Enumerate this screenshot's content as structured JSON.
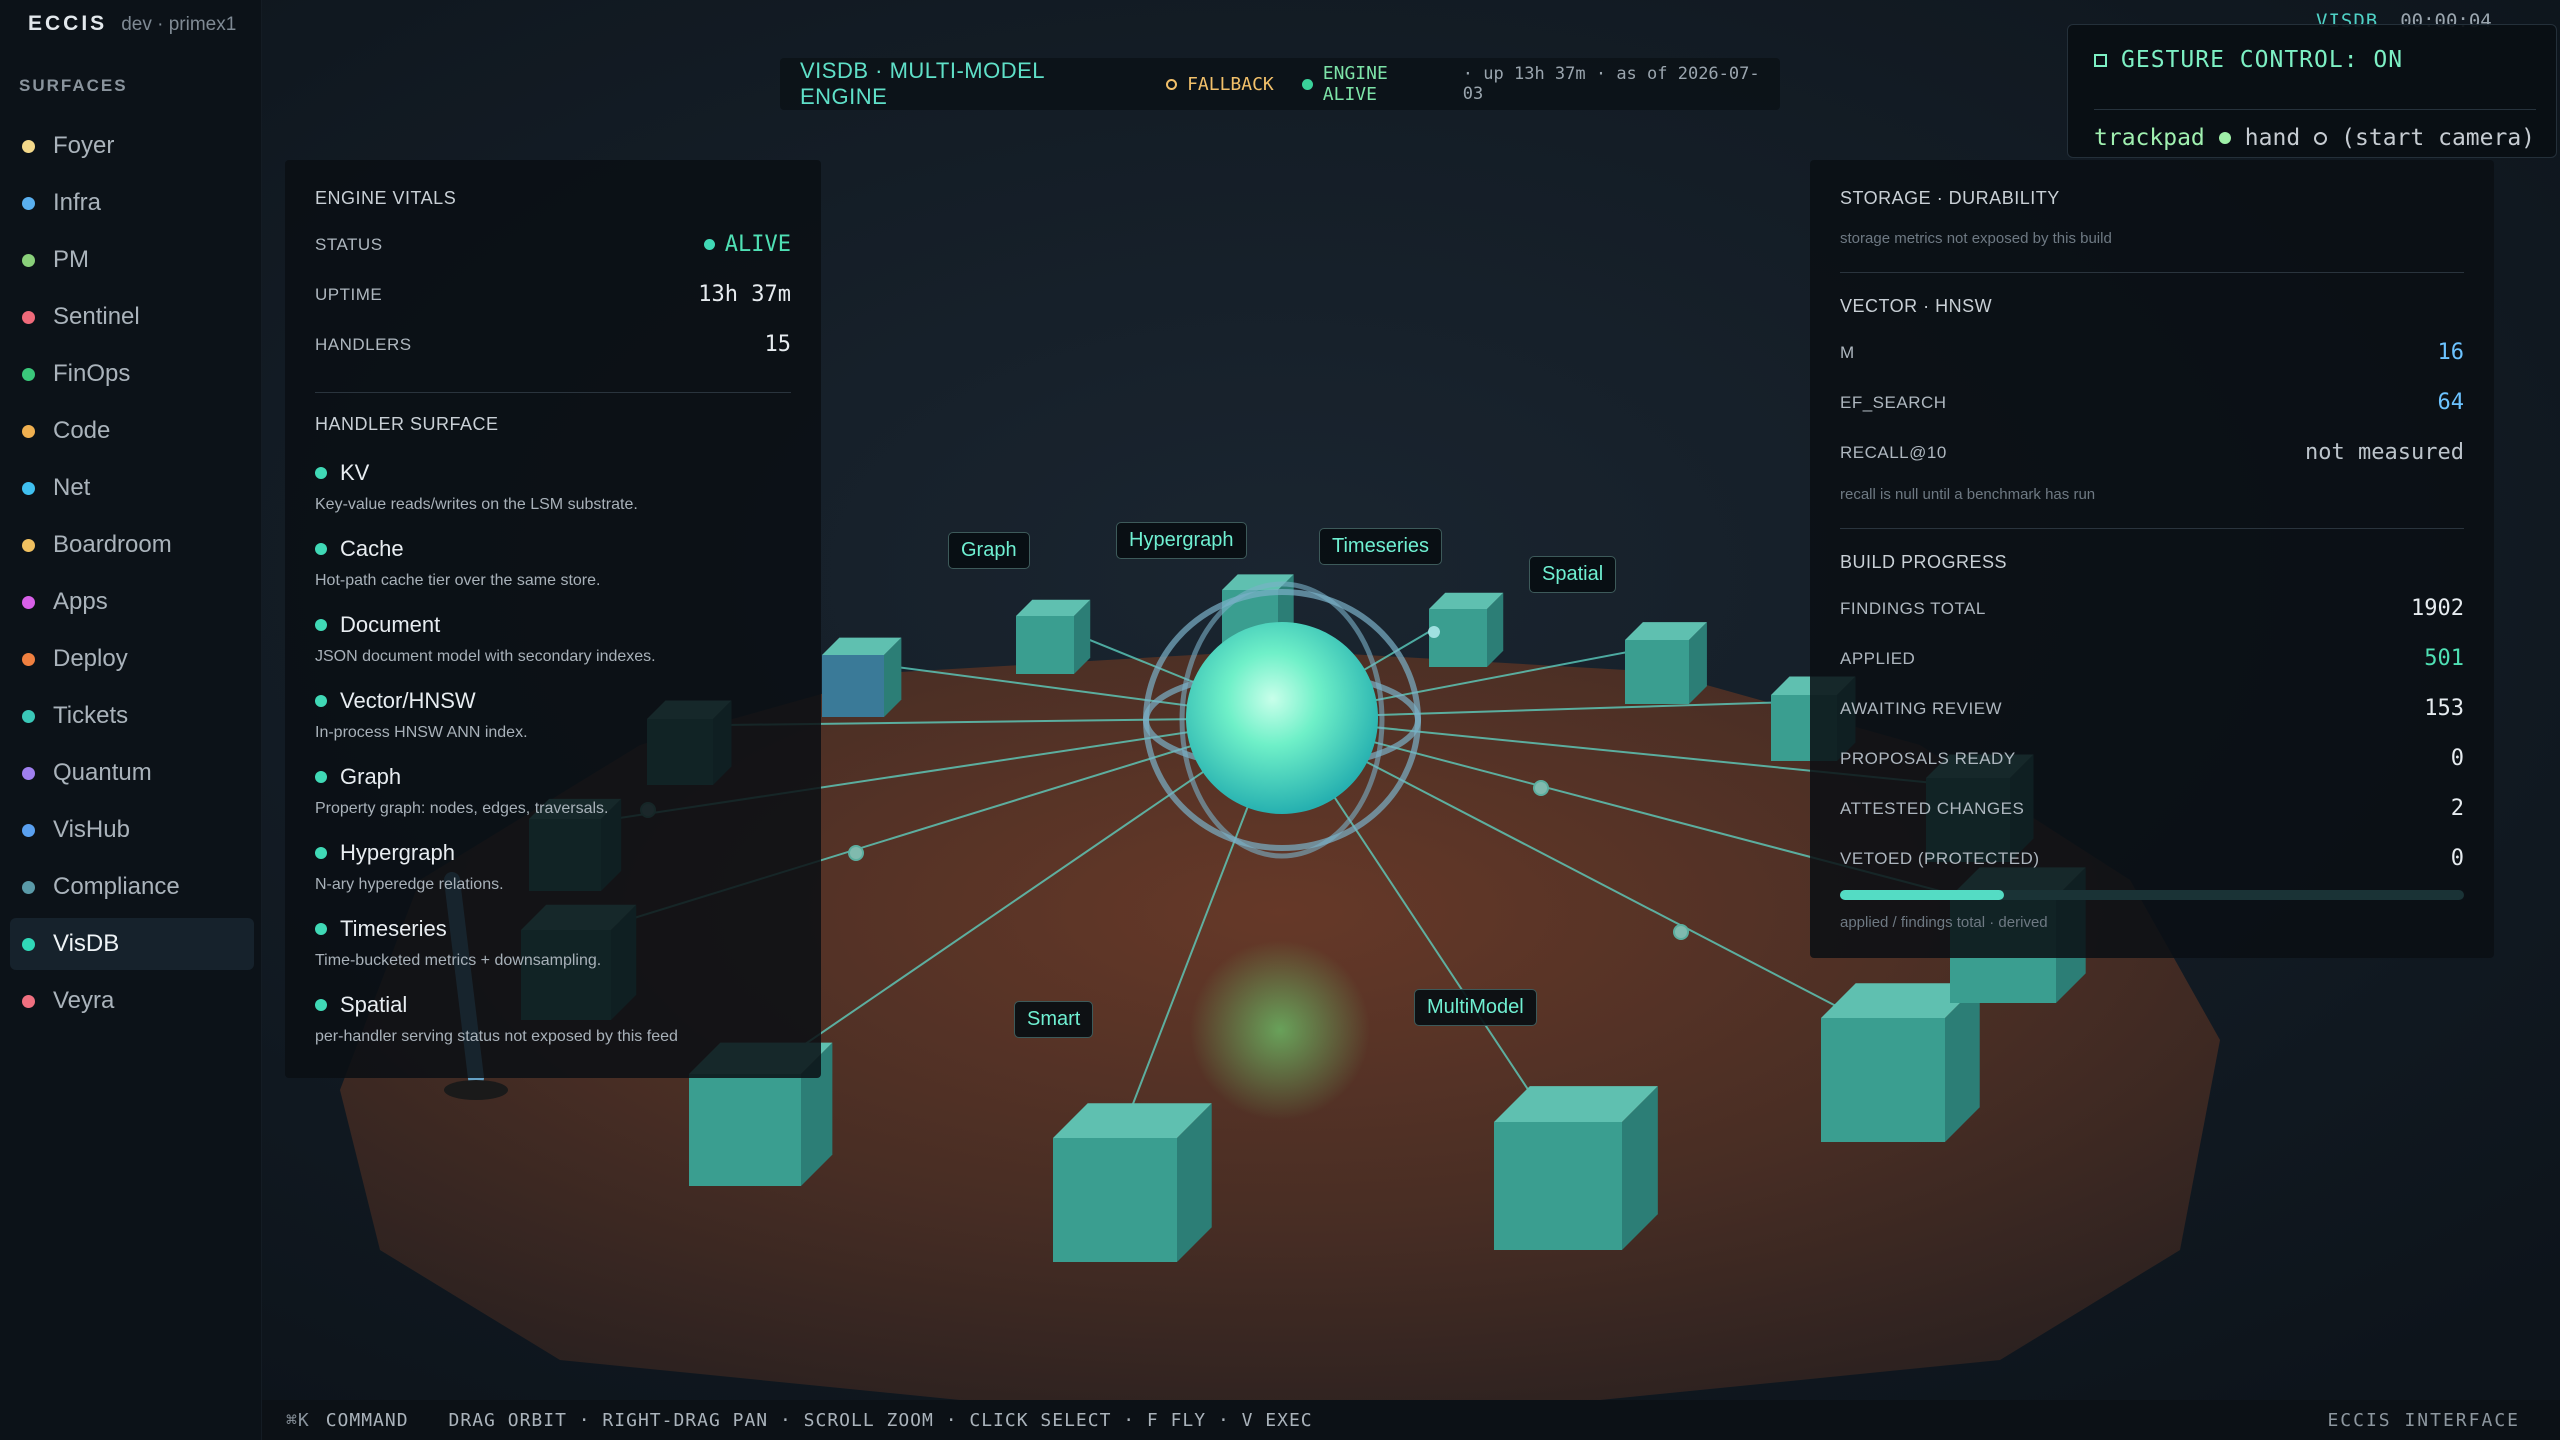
{
  "app": {
    "brand": "ECCIS",
    "env": "dev · primex1"
  },
  "sidebar": {
    "section_label": "SURFACES",
    "items": [
      {
        "label": "Foyer",
        "color": "#f4d98a",
        "active": false
      },
      {
        "label": "Infra",
        "color": "#5ab0f0",
        "active": false
      },
      {
        "label": "PM",
        "color": "#8ad07a",
        "active": false
      },
      {
        "label": "Sentinel",
        "color": "#f06a7a",
        "active": false
      },
      {
        "label": "FinOps",
        "color": "#3ac87a",
        "active": false
      },
      {
        "label": "Code",
        "color": "#f0b050",
        "active": false
      },
      {
        "label": "Net",
        "color": "#40c0f0",
        "active": false
      },
      {
        "label": "Boardroom",
        "color": "#f0c060",
        "active": false
      },
      {
        "label": "Apps",
        "color": "#d860e8",
        "active": false
      },
      {
        "label": "Deploy",
        "color": "#f08040",
        "active": false
      },
      {
        "label": "Tickets",
        "color": "#3ac8b8",
        "active": false
      },
      {
        "label": "Quantum",
        "color": "#a080f0",
        "active": false
      },
      {
        "label": "VisHub",
        "color": "#5aa0f0",
        "active": false
      },
      {
        "label": "Compliance",
        "color": "#5a9aa8",
        "active": false
      },
      {
        "label": "VisDB",
        "color": "#30d8b8",
        "active": true
      },
      {
        "label": "Veyra",
        "color": "#f07080",
        "active": false
      }
    ]
  },
  "header": {
    "title": "VISDB · MULTI-MODEL ENGINE",
    "fallback": "FALLBACK",
    "alive": "ENGINE ALIVE",
    "meta": "· up 13h 37m · as of 2026-07-03"
  },
  "topright": {
    "vis": "VISDB",
    "clock": "00:00:04"
  },
  "gesture": {
    "title": "GESTURE CONTROL: ON",
    "trackpad": "trackpad",
    "hand": "hand",
    "hand_hint": "(start camera)"
  },
  "vitals": {
    "title": "ENGINE VITALS",
    "status_k": "STATUS",
    "status_v": "ALIVE",
    "uptime_k": "UPTIME",
    "uptime_v": "13h 37m",
    "handlers_k": "HANDLERS",
    "handlers_v": "15"
  },
  "handlers": {
    "title": "HANDLER SURFACE",
    "items": [
      {
        "name": "KV",
        "desc": "Key-value reads/writes on the LSM substrate."
      },
      {
        "name": "Cache",
        "desc": "Hot-path cache tier over the same store."
      },
      {
        "name": "Document",
        "desc": "JSON document model with secondary indexes."
      },
      {
        "name": "Vector/HNSW",
        "desc": "In-process HNSW ANN index."
      },
      {
        "name": "Graph",
        "desc": "Property graph: nodes, edges, traversals."
      },
      {
        "name": "Hypergraph",
        "desc": "N-ary hyperedge relations."
      },
      {
        "name": "Timeseries",
        "desc": "Time-bucketed metrics + downsampling."
      },
      {
        "name": "Spatial",
        "desc": "per-handler serving status not exposed by this feed"
      }
    ]
  },
  "storage": {
    "title": "STORAGE · DURABILITY",
    "note": "storage metrics not exposed by this build"
  },
  "vector": {
    "title": "VECTOR · HNSW",
    "m_k": "M",
    "m_v": "16",
    "ef_k": "EF_SEARCH",
    "ef_v": "64",
    "recall_k": "RECALL@10",
    "recall_v": "not measured",
    "note": "recall is null until a benchmark has run"
  },
  "build": {
    "title": "BUILD PROGRESS",
    "findings_k": "FINDINGS TOTAL",
    "findings_v": "1902",
    "applied_k": "APPLIED",
    "applied_v": "501",
    "awaiting_k": "AWAITING REVIEW",
    "awaiting_v": "153",
    "proposals_k": "PROPOSALS READY",
    "proposals_v": "0",
    "attested_k": "ATTESTED CHANGES",
    "attested_v": "2",
    "vetoed_k": "VETOED (PROTECTED)",
    "vetoed_v": "0",
    "progress_fraction": 0.263,
    "note": "applied / findings total · derived"
  },
  "node_labels": {
    "graph": "Graph",
    "hypergraph": "Hypergraph",
    "timeseries": "Timeseries",
    "spatial": "Spatial",
    "smart": "Smart",
    "multimodel": "MultiModel"
  },
  "bottombar": {
    "cmd_key": "⌘K",
    "cmd": "COMMAND",
    "hints": "DRAG ORBIT · RIGHT-DRAG PAN · SCROLL ZOOM · CLICK SELECT · F FLY · V EXEC",
    "brand": "ECCIS INTERFACE"
  },
  "colors": {
    "accent": "#4fe0b4",
    "cube": "#3fa898",
    "platform": "#4a3028"
  }
}
